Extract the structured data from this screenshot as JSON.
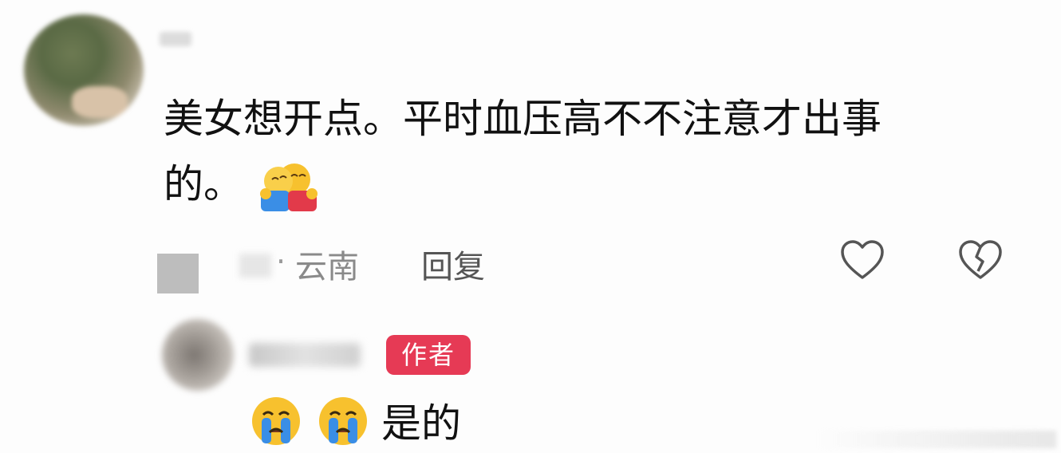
{
  "comment": {
    "text_line1": "美女想开点。平时血压高不不注意才出事",
    "text_line2": "的。",
    "emoji": "hug-emoji",
    "location": "云南",
    "reply_label": "回复",
    "like_icon": "heart-outline-icon",
    "dislike_icon": "broken-heart-icon"
  },
  "reply": {
    "badge": "作者",
    "emoji": "crying-face-emoji",
    "emoji_count": 2,
    "text": "是的"
  },
  "colors": {
    "badge": "#e63a55",
    "meta_text": "#8a8a8a",
    "body_text": "#111111",
    "emoji_yellow": "#f7c12e",
    "emoji_tears": "#3a8ee6"
  }
}
